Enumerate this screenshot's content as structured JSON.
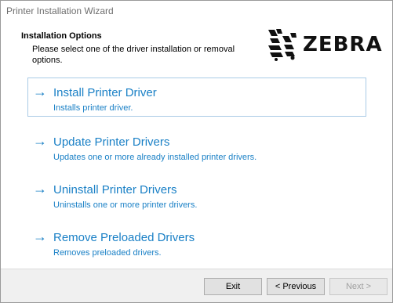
{
  "window": {
    "title": "Printer Installation Wizard"
  },
  "header": {
    "heading": "Installation Options",
    "description": "Please select one of the driver installation or removal options.",
    "logo_text": "ZEBRA"
  },
  "options": [
    {
      "label": "Install Printer Driver",
      "description": "Installs printer driver.",
      "selected": true
    },
    {
      "label": "Update Printer Drivers",
      "description": "Updates one or more already installed printer drivers.",
      "selected": false
    },
    {
      "label": "Uninstall Printer Drivers",
      "description": "Uninstalls one or more printer drivers.",
      "selected": false
    },
    {
      "label": "Remove Preloaded Drivers",
      "description": "Removes preloaded drivers.",
      "selected": false
    }
  ],
  "icons": {
    "option_arrow": "→",
    "logo": "zebra-head-icon"
  },
  "footer": {
    "exit_label": "Exit",
    "previous_label": "< Previous",
    "next_label": "Next >",
    "next_enabled": false
  },
  "colors": {
    "link": "#1a80c6",
    "selected_border": "#a9cbe6",
    "footer_bg": "#f0f0f0"
  }
}
